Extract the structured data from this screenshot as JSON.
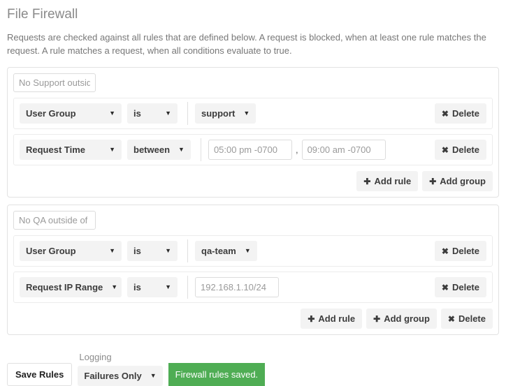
{
  "header": {
    "title": "File Firewall",
    "description": "Requests are checked against all rules that are defined below. A request is blocked, when at least one rule matches the request. A rule matches a request, when all conditions evaluate to true."
  },
  "icons": {
    "caret_down": "▼",
    "delete_glyph": "✖",
    "add_glyph": "✚"
  },
  "labels": {
    "add_rule": "Add rule",
    "add_group": "Add group",
    "delete": "Delete",
    "comma": ","
  },
  "colors": {
    "success_bg": "#4fad54",
    "control_bg": "#f3f3f3",
    "panel_border": "#e2e2e2"
  },
  "groups": [
    {
      "name_value": "No Support outside",
      "rules": [
        {
          "field": "User Group",
          "operator": "is",
          "value_type": "dropdown",
          "value": "support",
          "delete_label": "Delete"
        },
        {
          "field": "Request Time",
          "operator": "between",
          "value_type": "time_range",
          "value_from": "05:00 pm -0700",
          "value_to": "09:00 am -0700",
          "delete_label": "Delete"
        }
      ],
      "footer_buttons": [
        "Add rule",
        "Add group"
      ]
    },
    {
      "name_value": "No QA outside of th",
      "rules": [
        {
          "field": "User Group",
          "operator": "is",
          "value_type": "dropdown",
          "value": "qa-team",
          "delete_label": "Delete"
        },
        {
          "field": "Request IP Range",
          "operator": "is",
          "value_type": "text",
          "value": "192.168.1.10/24",
          "delete_label": "Delete"
        }
      ],
      "footer_buttons": [
        "Add rule",
        "Add group",
        "Delete"
      ]
    }
  ],
  "bottom_bar": {
    "save_label": "Save Rules",
    "logging_label": "Logging",
    "logging_value": "Failures Only",
    "status_message": "Firewall rules saved."
  }
}
